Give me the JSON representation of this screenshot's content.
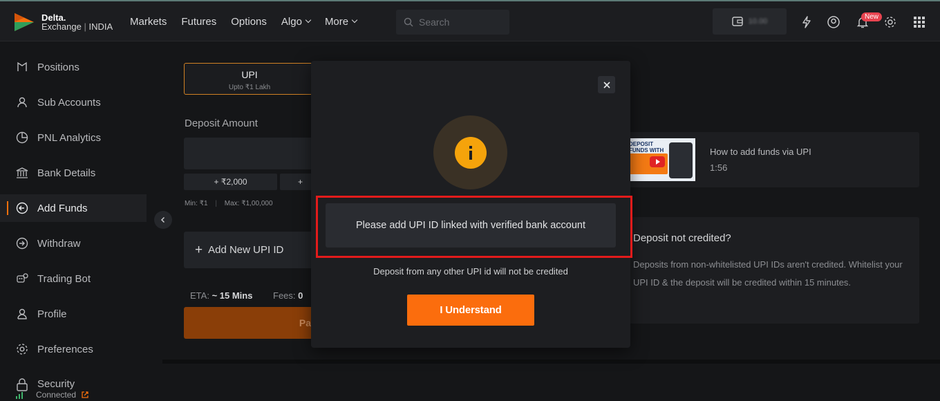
{
  "brand": {
    "name": "Delta.",
    "sub": "Exchange",
    "region": "INDIA"
  },
  "nav": {
    "markets": "Markets",
    "futures": "Futures",
    "options": "Options",
    "algo": "Algo",
    "more": "More"
  },
  "search": {
    "placeholder": "Search"
  },
  "wallet": {
    "balance": "10.00"
  },
  "notifications": {
    "badge": "New"
  },
  "sidebar": {
    "items": [
      {
        "label": "Positions",
        "icon": "positions-icon"
      },
      {
        "label": "Sub Accounts",
        "icon": "user-icon"
      },
      {
        "label": "PNL Analytics",
        "icon": "pie-chart-icon"
      },
      {
        "label": "Bank Details",
        "icon": "bank-icon"
      },
      {
        "label": "Add Funds",
        "icon": "add-funds-icon",
        "active": true
      },
      {
        "label": "Withdraw",
        "icon": "withdraw-icon"
      },
      {
        "label": "Trading Bot",
        "icon": "bot-icon"
      },
      {
        "label": "Profile",
        "icon": "profile-icon"
      },
      {
        "label": "Preferences",
        "icon": "gear-icon"
      },
      {
        "label": "Security",
        "icon": "lock-icon"
      }
    ]
  },
  "status": {
    "connected": "Connected"
  },
  "deposit": {
    "tab_title": "UPI",
    "tab_sub": "Upto ₹1 Lakh",
    "amount_label": "Deposit Amount",
    "chip_1": "+ ₹2,000",
    "chip_2": "+",
    "min": "Min: ₹1",
    "max": "Max: ₹1,00,000",
    "add_upi": "Add New UPI ID",
    "eta_label": "ETA:",
    "eta_value": "~ 15 Mins",
    "fees_label": "Fees:",
    "fees_value": "0",
    "pay_label": "Pa"
  },
  "video": {
    "title": "How to add funds via UPI",
    "duration": "1:56",
    "thumb_text": "DEPOSIT FUNDS WITH UPI"
  },
  "info_card": {
    "title": "Deposit not credited?",
    "body": "Deposits from non-whitelisted UPI IDs aren't credited. Whitelist your UPI ID & the deposit will be credited within 15 minutes."
  },
  "modal": {
    "message": "Please add UPI ID linked with verified bank account",
    "sub_message": "Deposit from any other UPI id will not be credited",
    "button": "I Understand"
  },
  "colors": {
    "accent": "#fb6d0d",
    "warning": "#f5a30b",
    "highlight": "#e31b1b"
  }
}
